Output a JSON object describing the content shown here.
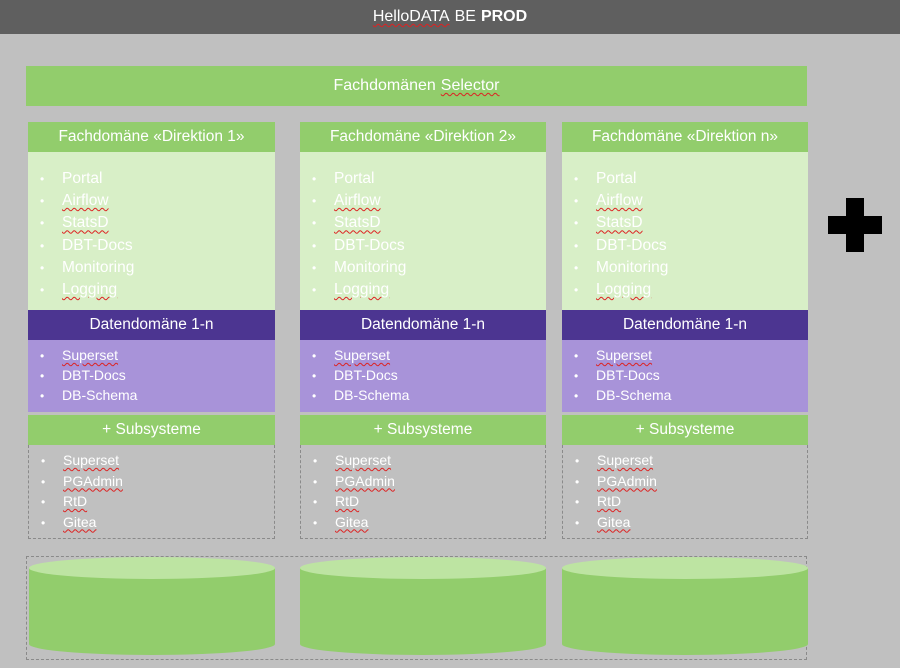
{
  "header": {
    "title_prefix": "HelloDATA",
    "title_mid": "BE",
    "title_env": "PROD"
  },
  "selector": {
    "label_prefix": "Fachdomänen",
    "label_word": "Selector"
  },
  "columns": [
    {
      "header": "Fachdomäne «Direktion 1»",
      "services": [
        "Portal",
        "Airflow",
        "StatsD",
        "DBT-Docs",
        "Monitoring",
        "Logging"
      ],
      "datendomaene_header": "Datendomäne 1-n",
      "datendomaene_items": [
        "Superset",
        "DBT-Docs",
        "DB-Schema"
      ],
      "subsysteme_header": "+ Subsysteme",
      "subsysteme_items": [
        "Superset",
        "PGAdmin",
        "RtD",
        "Gitea"
      ]
    },
    {
      "header": "Fachdomäne «Direktion 2»",
      "services": [
        "Portal",
        "Airflow",
        "StatsD",
        "DBT-Docs",
        "Monitoring",
        "Logging"
      ],
      "datendomaene_header": "Datendomäne 1-n",
      "datendomaene_items": [
        "Superset",
        "DBT-Docs",
        "DB-Schema"
      ],
      "subsysteme_header": "+ Subsysteme",
      "subsysteme_items": [
        "Superset",
        "PGAdmin",
        "RtD",
        "Gitea"
      ]
    },
    {
      "header": "Fachdomäne «Direktion n»",
      "services": [
        "Portal",
        "Airflow",
        "StatsD",
        "DBT-Docs",
        "Monitoring",
        "Logging"
      ],
      "datendomaene_header": "Datendomäne 1-n",
      "datendomaene_items": [
        "Superset",
        "DBT-Docs",
        "DB-Schema"
      ],
      "subsysteme_header": "+ Subsysteme",
      "subsysteme_items": [
        "Superset",
        "PGAdmin",
        "RtD",
        "Gitea"
      ]
    }
  ],
  "colors": {
    "green": "#92cd6c",
    "light_green": "#d8efc7",
    "purple": "#4c3591",
    "light_purple": "#a893d9",
    "background": "#c0c0c0",
    "topbar": "#5f5f5f"
  },
  "icons": {
    "plus": "plus-icon",
    "database": "database-cylinder-icon"
  }
}
